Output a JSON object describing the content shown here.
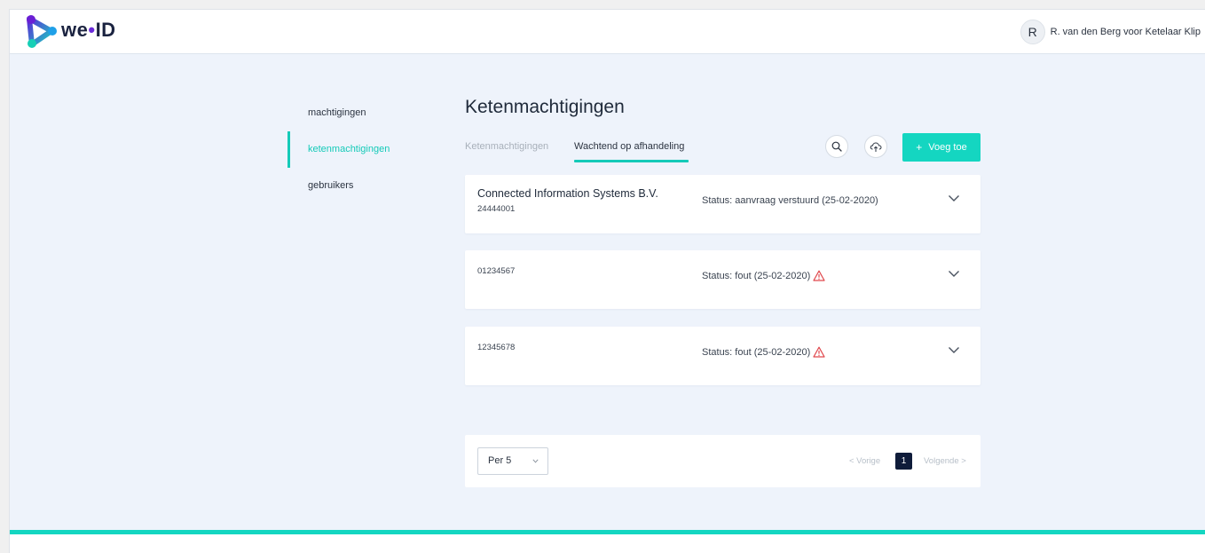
{
  "header": {
    "brand": {
      "part1": "we",
      "dot": "•",
      "part2": "ID"
    },
    "avatar_initial": "R",
    "user_name": "R. van den Berg voor Ketelaar Klip"
  },
  "sidebar": {
    "items": [
      {
        "label": "machtigingen",
        "active": false
      },
      {
        "label": "ketenmachtigingen",
        "active": true
      },
      {
        "label": "gebruikers",
        "active": false
      }
    ]
  },
  "main": {
    "title": "Ketenmachtigingen",
    "tabs": [
      {
        "label": "Ketenmachtigingen",
        "active": false
      },
      {
        "label": "Wachtend op afhandeling",
        "active": true
      }
    ],
    "add_button_label": "Voeg toe",
    "add_button_plus": "+",
    "icons": {
      "search": "search-icon",
      "upload": "cloud-upload-icon",
      "warning": "warning-icon",
      "expand": "chevron-down-icon"
    },
    "items": [
      {
        "name": "Connected Information Systems B.V.",
        "id": "24444001",
        "status": "Status: aanvraag verstuurd (25-02-2020)",
        "warning": false
      },
      {
        "name": "",
        "id": "01234567",
        "status": "Status: fout (25-02-2020)",
        "warning": true
      },
      {
        "name": "",
        "id": "12345678",
        "status": "Status: fout (25-02-2020)",
        "warning": true
      }
    ],
    "pagination": {
      "per_page_label": "Per 5",
      "prev_label": "< Vorige",
      "current_page": "1",
      "next_label": "Volgende >"
    }
  },
  "colors": {
    "accent": "#14d6c1",
    "accent_text": "#14cab8",
    "page_active": "#0f1c3a",
    "warning": "#e0474c",
    "background": "#eef3fb"
  }
}
